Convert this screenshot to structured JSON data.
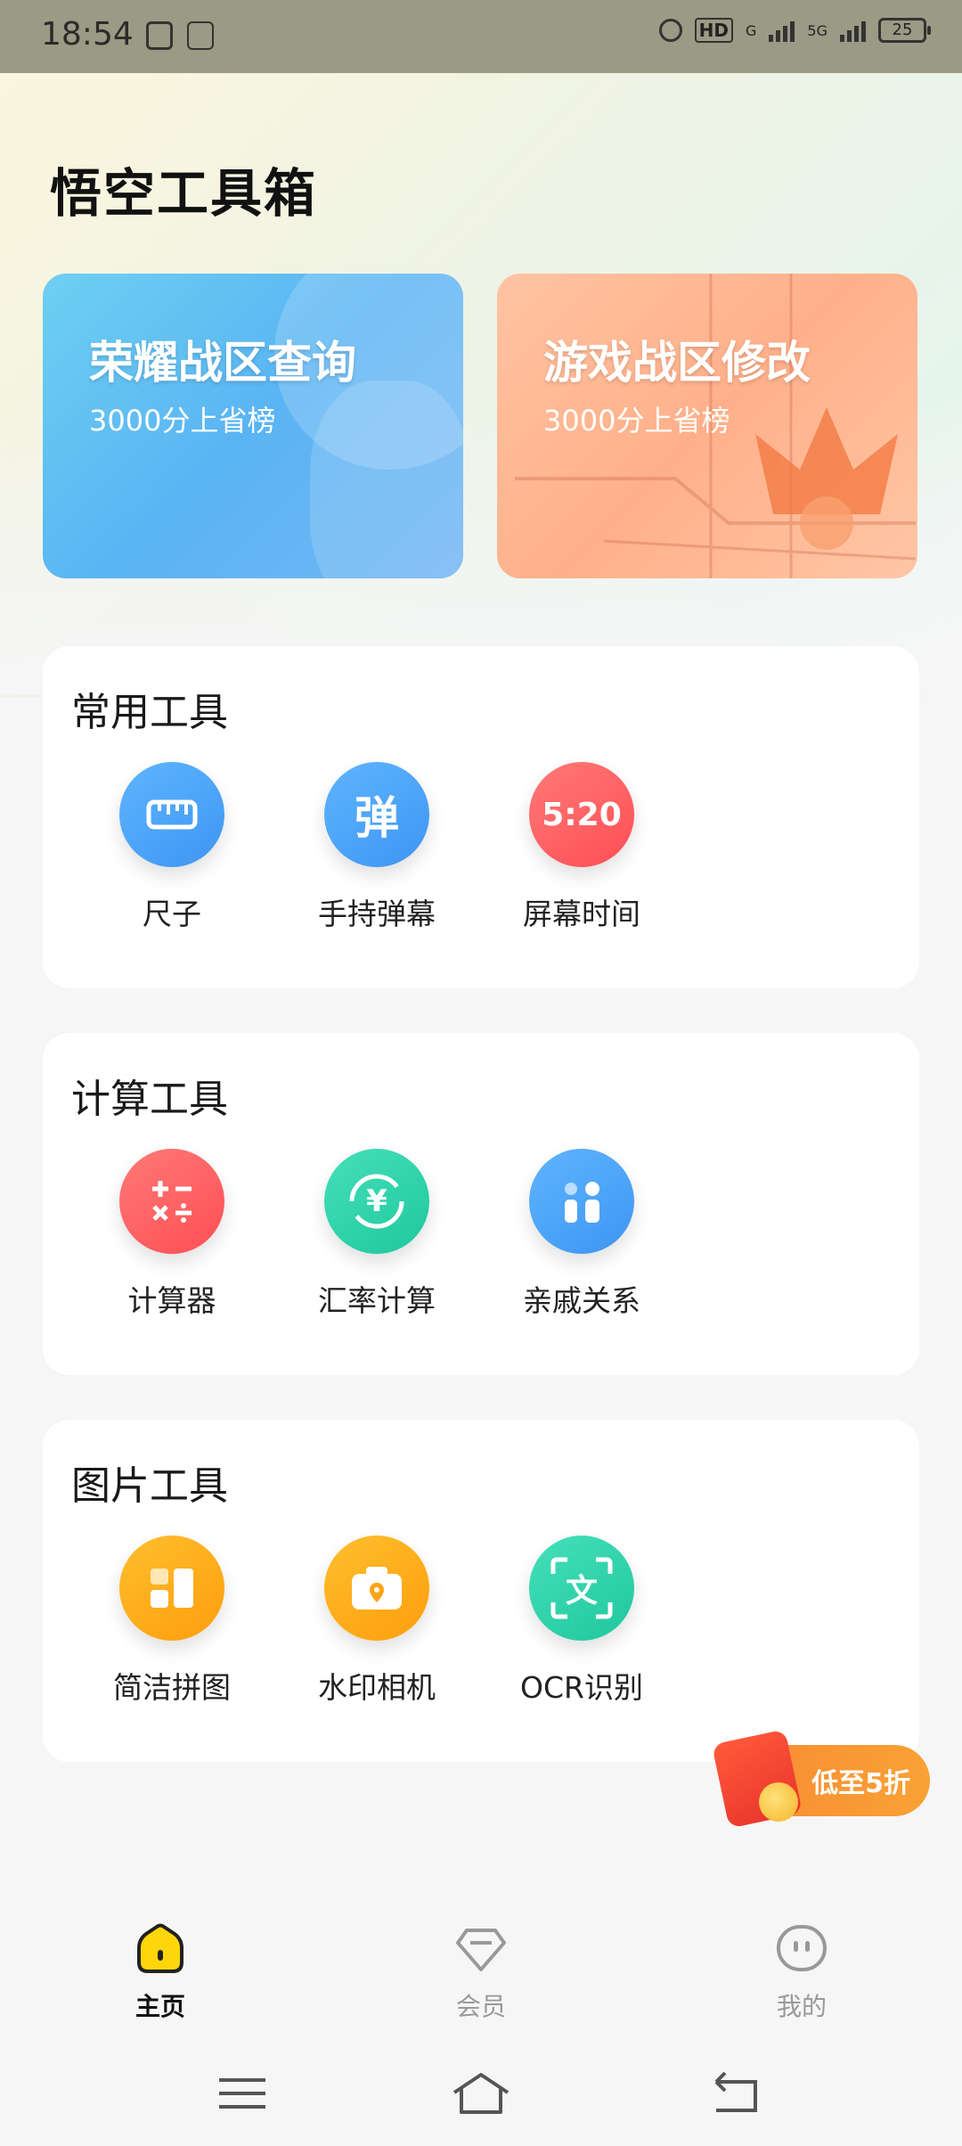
{
  "status_bar": {
    "time": "18:54",
    "network_label": "HD",
    "network_type_1": "G",
    "network_type_2": "5G",
    "battery": "25"
  },
  "page": {
    "title": "悟空工具箱"
  },
  "banners": [
    {
      "title": "荣耀战区查询",
      "subtitle": "3000分上省榜"
    },
    {
      "title": "游戏战区修改",
      "subtitle": "3000分上省榜"
    }
  ],
  "sections": [
    {
      "title": "常用工具",
      "tools": [
        {
          "label": "尺子",
          "icon": "ruler-icon"
        },
        {
          "label": "手持弹幕",
          "icon": "danmaku-icon",
          "glyph": "弹"
        },
        {
          "label": "屏幕时间",
          "icon": "screen-time-icon",
          "glyph": "5:20"
        }
      ]
    },
    {
      "title": "计算工具",
      "tools": [
        {
          "label": "计算器",
          "icon": "calculator-icon"
        },
        {
          "label": "汇率计算",
          "icon": "exchange-rate-icon",
          "glyph": "¥"
        },
        {
          "label": "亲戚关系",
          "icon": "relatives-icon"
        }
      ]
    },
    {
      "title": "图片工具",
      "tools": [
        {
          "label": "简洁拼图",
          "icon": "collage-icon"
        },
        {
          "label": "水印相机",
          "icon": "watermark-camera-icon"
        },
        {
          "label": "OCR识别",
          "icon": "ocr-icon",
          "glyph": "文"
        }
      ]
    }
  ],
  "promo": {
    "label": "低至5折"
  },
  "bottom_nav": [
    {
      "label": "主页",
      "icon": "home-icon",
      "active": true
    },
    {
      "label": "会员",
      "icon": "vip-gem-icon",
      "active": false
    },
    {
      "label": "我的",
      "icon": "profile-icon",
      "active": false
    }
  ],
  "colors": {
    "blue": "#4aa5f5",
    "red": "#ff6064",
    "green": "#2fd6ae",
    "orange": "#ffac18"
  }
}
